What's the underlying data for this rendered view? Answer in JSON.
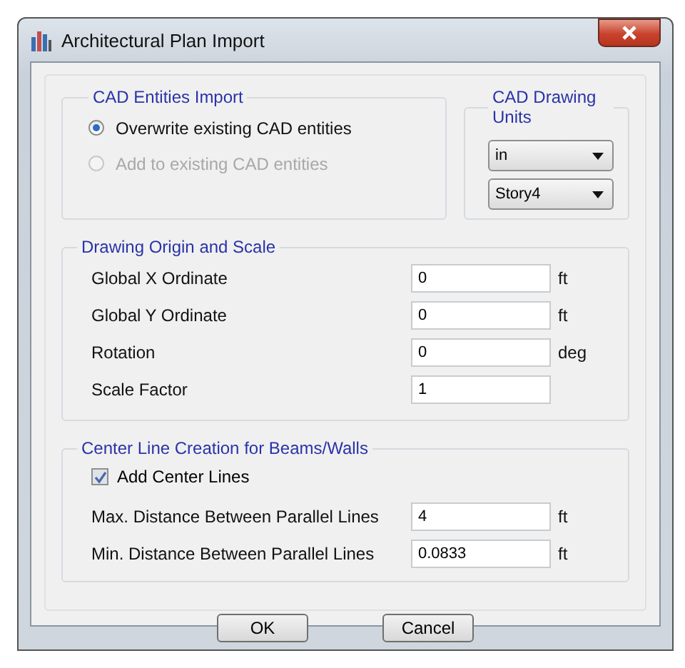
{
  "window": {
    "title": "Architectural Plan Import"
  },
  "import_group": {
    "title": "CAD Entities Import",
    "options": [
      {
        "label": "Overwrite existing CAD entities",
        "selected": true,
        "disabled": false
      },
      {
        "label": "Add to existing CAD entities",
        "selected": false,
        "disabled": true
      }
    ]
  },
  "units_group": {
    "title": "CAD Drawing Units",
    "dropdowns": [
      {
        "value": "in"
      },
      {
        "value": "Story4"
      }
    ]
  },
  "origin_group": {
    "title": "Drawing Origin and Scale",
    "fields": [
      {
        "label": "Global  X Ordinate",
        "value": "0",
        "unit": "ft"
      },
      {
        "label": "Global  Y Ordinate",
        "value": "0",
        "unit": "ft"
      },
      {
        "label": "Rotation",
        "value": "0",
        "unit": "deg"
      },
      {
        "label": "Scale Factor",
        "value": "1"
      }
    ]
  },
  "centerline_group": {
    "title": "Center Line Creation for Beams/Walls",
    "checkbox": {
      "label": "Add Center Lines",
      "checked": true
    },
    "fields": [
      {
        "label": "Max. Distance Between Parallel Lines",
        "value": "4",
        "unit": "ft"
      },
      {
        "label": "Min. Distance Between Parallel Lines",
        "value": "0.0833",
        "unit": "ft"
      }
    ]
  },
  "buttons": [
    "OK",
    "Cancel"
  ]
}
